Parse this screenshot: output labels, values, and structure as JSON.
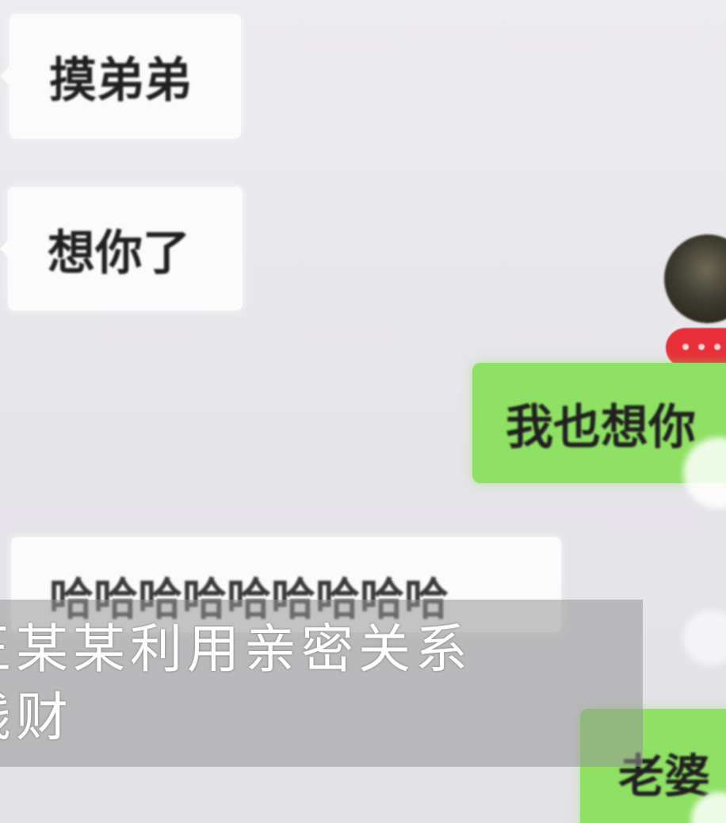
{
  "chat": {
    "messages": [
      {
        "side": "left",
        "text": "摸弟弟"
      },
      {
        "side": "left",
        "text": "想你了"
      },
      {
        "side": "right",
        "text": "我也想你"
      },
      {
        "side": "left",
        "text": "哈哈哈哈哈哈哈哈哈"
      },
      {
        "side": "right",
        "text": "老婆"
      }
    ],
    "colors": {
      "left_bubble": "#fbfbfc",
      "right_bubble": "#8fe064",
      "badge": "#e8303a"
    }
  },
  "caption": {
    "line1": "王某某利用亲密关系",
    "line2": "钱财"
  }
}
